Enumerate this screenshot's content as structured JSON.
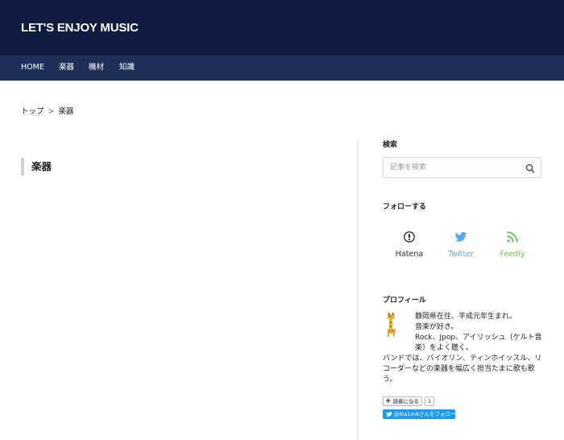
{
  "header": {
    "site_title": "LET'S ENJOY MUSIC"
  },
  "nav": {
    "items": [
      "HOME",
      "楽器",
      "機材",
      "知識"
    ]
  },
  "breadcrumb": {
    "home": "トップ",
    "separator": ">",
    "current": "楽器"
  },
  "page": {
    "heading": "楽器"
  },
  "sidebar": {
    "search": {
      "title": "検索",
      "placeholder": "記事を検索"
    },
    "follow": {
      "title": "フォローする",
      "items": [
        {
          "label": "Hatena",
          "icon": "hatena-icon",
          "color": "#333333"
        },
        {
          "label": "Twitter",
          "icon": "twitter-bird-icon",
          "color": "#55acee"
        },
        {
          "label": "Feedly",
          "icon": "rss-feed-icon",
          "color": "#6cc655"
        }
      ]
    },
    "profile": {
      "title": "プロフィール",
      "lines": [
        "静岡県在住、平成元年生まれ。",
        "音楽が好き。",
        "Rock、Jpop、アイリッシュ（ケルト音",
        "楽）をよく聴く。",
        "バンドでは、バイオリン、ティンホイッスル、リ",
        "コーダーなどの楽器を幅広く担当たまに歌も歌",
        "う。"
      ],
      "reader_button": "読者になる",
      "reader_count": "1",
      "twitter_follow": "@l0a1m8さんをフォロー"
    }
  },
  "colors": {
    "header_bg": "#0f1b40",
    "nav_bg": "#1f2f59",
    "twitter": "#1d9bf0"
  }
}
